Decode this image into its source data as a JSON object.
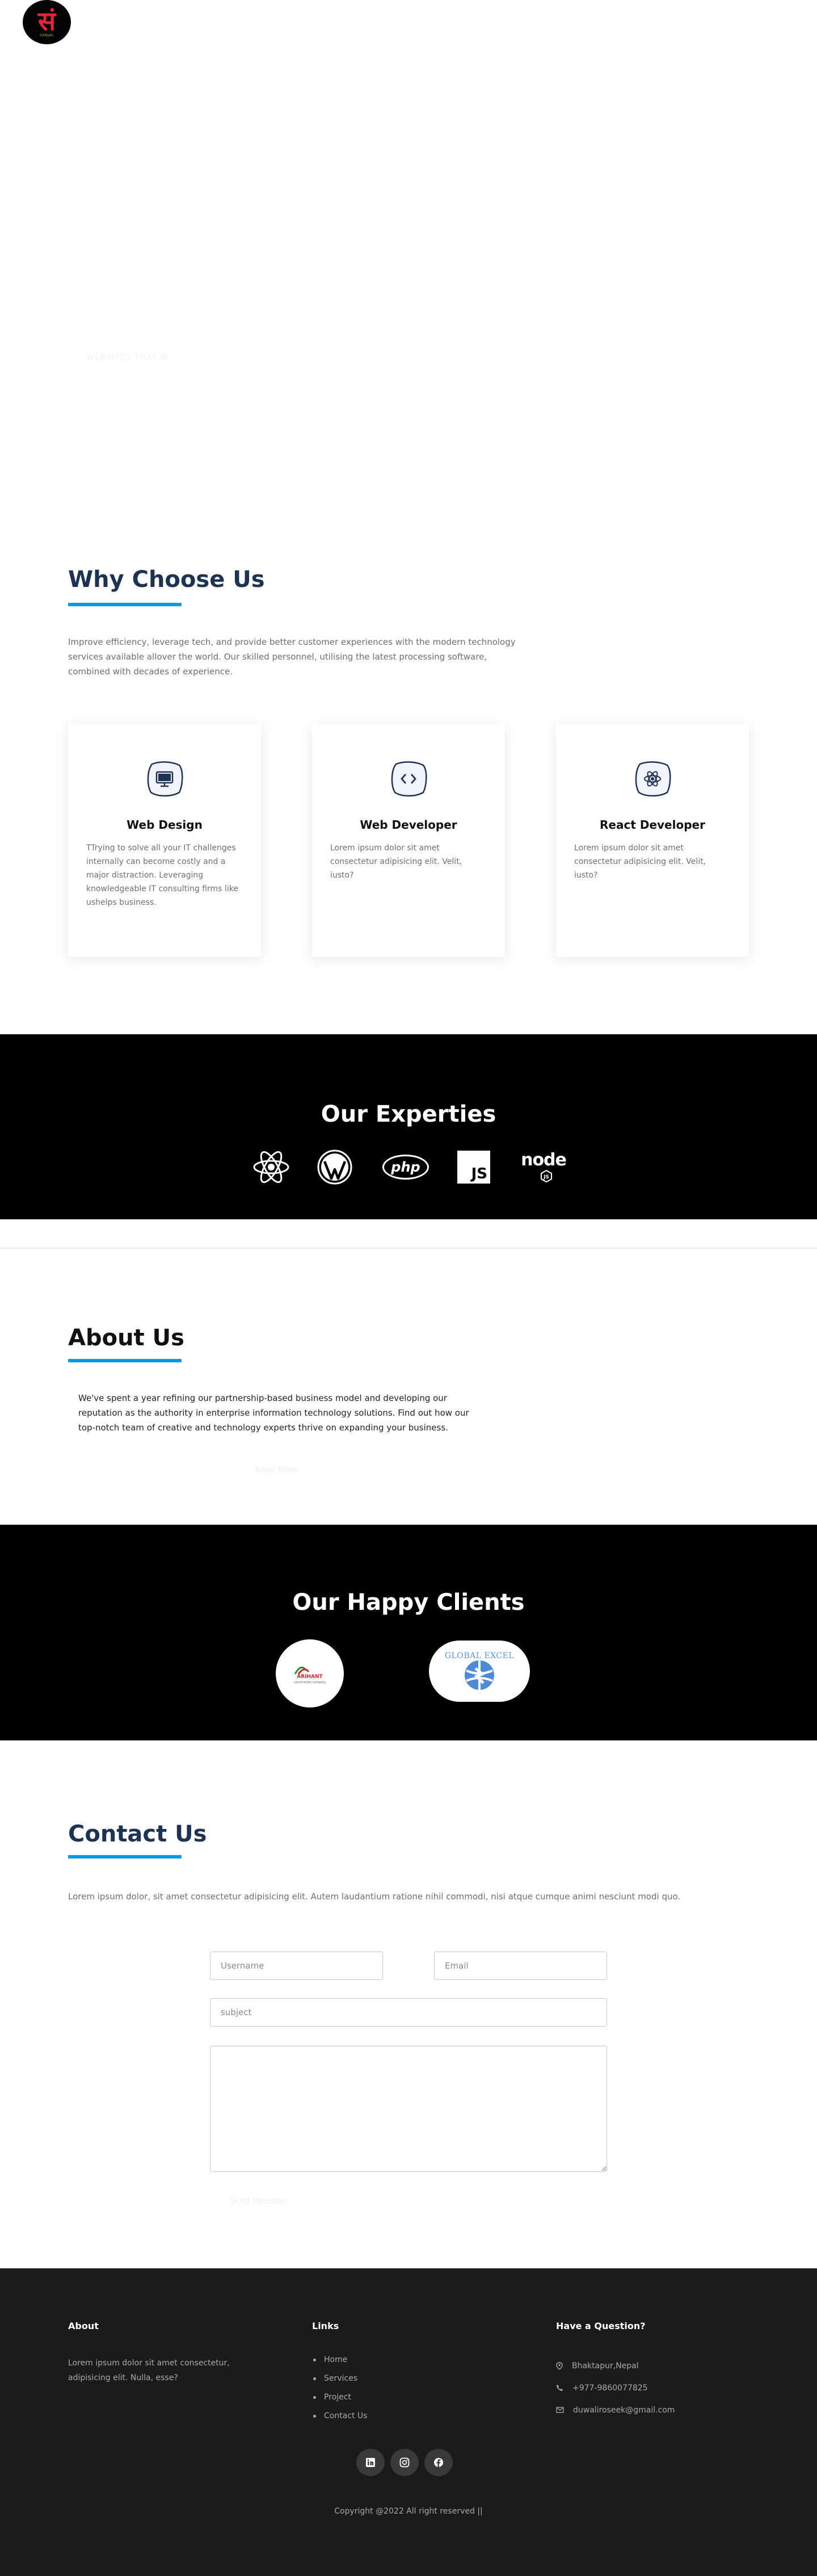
{
  "header": {
    "logo_glyph": "सं",
    "logo_tagline": "SANJAL"
  },
  "hero": {
    "faint_text": "WEBSITES THAT W"
  },
  "why": {
    "title": "Why Choose Us",
    "paragraph": "Improve efficiency, leverage tech, and provide better customer experiences with the modern technology services available allover the world. Our skilled personnel, utilising the latest processing software, combined with decades of experience.",
    "cards": [
      {
        "icon": "monitor-icon",
        "title": "Web Design",
        "text": "TTrying to solve all your IT challenges internally can become costly and a major distraction. Leveraging knowledgeable IT consulting firms like ushelps business."
      },
      {
        "icon": "code-icon",
        "title": "Web Developer",
        "text": "Lorem ipsum dolor sit amet consectetur adipisicing elit. Velit, iusto?"
      },
      {
        "icon": "react-icon",
        "title": "React Developer",
        "text": "Lorem ipsum dolor sit amet consectetur adipisicing elit. Velit, iusto?"
      }
    ]
  },
  "expertise": {
    "title": "Our Experties",
    "logos": [
      "react-logo-icon",
      "wordpress-logo-icon",
      "php-logo-icon",
      "javascript-logo-icon",
      "nodejs-logo-icon"
    ],
    "php_text": "php",
    "js_text": "JS",
    "node_text": "node"
  },
  "about": {
    "title": "About Us",
    "paragraph": "We've spent a year refining our partnership-based business model and developing our reputation as the authority in enterprise information technology solutions. Find out how our top-notch team of creative and technology experts thrive on expanding your business.",
    "faint_text": "Read More"
  },
  "clients": {
    "title": "Our Happy Clients",
    "items": [
      {
        "name": "client-logo-1",
        "text": "ARIHANT",
        "subtext": "construction company"
      },
      {
        "name": "client-logo-2",
        "text": "GLOBAL EXCEL"
      }
    ]
  },
  "contact": {
    "title": "Contact Us",
    "paragraph": "Lorem ipsum dolor, sit amet consectetur adipisicing elit. Autem laudantium ratione nihil commodi, nisi atque cumque animi nesciunt modi quo.",
    "username_placeholder": "Username",
    "email_placeholder": "Email",
    "subject_placeholder": "subject",
    "message_placeholder": "",
    "send_label": "Send Message"
  },
  "footer": {
    "about_heading": "About",
    "about_text": "Lorem ipsum dolor sit amet consectetur, adipisicing elit. Nulla, esse?",
    "links_heading": "Links",
    "links": [
      "Home",
      "Services",
      "Project",
      "Contact Us"
    ],
    "question_heading": "Have a Question?",
    "address": "Bhaktapur,Nepal",
    "phone": "+977-9860077825",
    "email": "duwaliroseek@gmail.com",
    "socials": [
      "linkedin-icon",
      "instagram-icon",
      "facebook-icon"
    ],
    "copyright": "Copyright @2022 All right reserved ||"
  },
  "colors": {
    "heading": "#1e3251",
    "accent": "#0d98e6",
    "band": "#000000",
    "footer": "#1b1b1b"
  }
}
